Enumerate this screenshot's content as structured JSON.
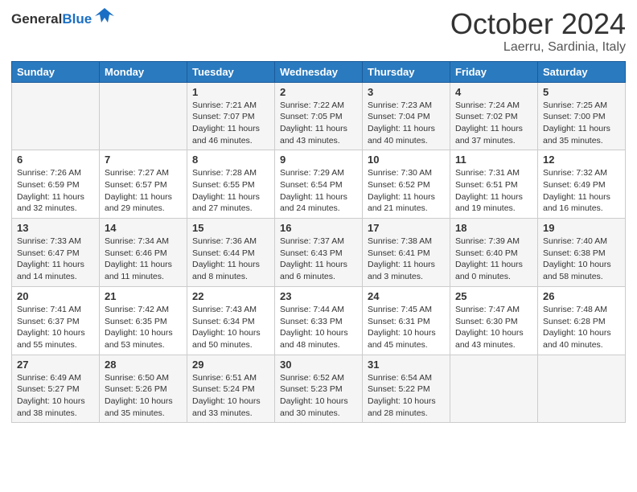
{
  "header": {
    "logo_general": "General",
    "logo_blue": "Blue",
    "month_title": "October 2024",
    "location": "Laerru, Sardinia, Italy"
  },
  "days_of_week": [
    "Sunday",
    "Monday",
    "Tuesday",
    "Wednesday",
    "Thursday",
    "Friday",
    "Saturday"
  ],
  "weeks": [
    [
      null,
      null,
      {
        "day": 1,
        "sunrise": "7:21 AM",
        "sunset": "7:07 PM",
        "daylight": "11 hours and 46 minutes."
      },
      {
        "day": 2,
        "sunrise": "7:22 AM",
        "sunset": "7:05 PM",
        "daylight": "11 hours and 43 minutes."
      },
      {
        "day": 3,
        "sunrise": "7:23 AM",
        "sunset": "7:04 PM",
        "daylight": "11 hours and 40 minutes."
      },
      {
        "day": 4,
        "sunrise": "7:24 AM",
        "sunset": "7:02 PM",
        "daylight": "11 hours and 37 minutes."
      },
      {
        "day": 5,
        "sunrise": "7:25 AM",
        "sunset": "7:00 PM",
        "daylight": "11 hours and 35 minutes."
      }
    ],
    [
      {
        "day": 6,
        "sunrise": "7:26 AM",
        "sunset": "6:59 PM",
        "daylight": "11 hours and 32 minutes."
      },
      {
        "day": 7,
        "sunrise": "7:27 AM",
        "sunset": "6:57 PM",
        "daylight": "11 hours and 29 minutes."
      },
      {
        "day": 8,
        "sunrise": "7:28 AM",
        "sunset": "6:55 PM",
        "daylight": "11 hours and 27 minutes."
      },
      {
        "day": 9,
        "sunrise": "7:29 AM",
        "sunset": "6:54 PM",
        "daylight": "11 hours and 24 minutes."
      },
      {
        "day": 10,
        "sunrise": "7:30 AM",
        "sunset": "6:52 PM",
        "daylight": "11 hours and 21 minutes."
      },
      {
        "day": 11,
        "sunrise": "7:31 AM",
        "sunset": "6:51 PM",
        "daylight": "11 hours and 19 minutes."
      },
      {
        "day": 12,
        "sunrise": "7:32 AM",
        "sunset": "6:49 PM",
        "daylight": "11 hours and 16 minutes."
      }
    ],
    [
      {
        "day": 13,
        "sunrise": "7:33 AM",
        "sunset": "6:47 PM",
        "daylight": "11 hours and 14 minutes."
      },
      {
        "day": 14,
        "sunrise": "7:34 AM",
        "sunset": "6:46 PM",
        "daylight": "11 hours and 11 minutes."
      },
      {
        "day": 15,
        "sunrise": "7:36 AM",
        "sunset": "6:44 PM",
        "daylight": "11 hours and 8 minutes."
      },
      {
        "day": 16,
        "sunrise": "7:37 AM",
        "sunset": "6:43 PM",
        "daylight": "11 hours and 6 minutes."
      },
      {
        "day": 17,
        "sunrise": "7:38 AM",
        "sunset": "6:41 PM",
        "daylight": "11 hours and 3 minutes."
      },
      {
        "day": 18,
        "sunrise": "7:39 AM",
        "sunset": "6:40 PM",
        "daylight": "11 hours and 0 minutes."
      },
      {
        "day": 19,
        "sunrise": "7:40 AM",
        "sunset": "6:38 PM",
        "daylight": "10 hours and 58 minutes."
      }
    ],
    [
      {
        "day": 20,
        "sunrise": "7:41 AM",
        "sunset": "6:37 PM",
        "daylight": "10 hours and 55 minutes."
      },
      {
        "day": 21,
        "sunrise": "7:42 AM",
        "sunset": "6:35 PM",
        "daylight": "10 hours and 53 minutes."
      },
      {
        "day": 22,
        "sunrise": "7:43 AM",
        "sunset": "6:34 PM",
        "daylight": "10 hours and 50 minutes."
      },
      {
        "day": 23,
        "sunrise": "7:44 AM",
        "sunset": "6:33 PM",
        "daylight": "10 hours and 48 minutes."
      },
      {
        "day": 24,
        "sunrise": "7:45 AM",
        "sunset": "6:31 PM",
        "daylight": "10 hours and 45 minutes."
      },
      {
        "day": 25,
        "sunrise": "7:47 AM",
        "sunset": "6:30 PM",
        "daylight": "10 hours and 43 minutes."
      },
      {
        "day": 26,
        "sunrise": "7:48 AM",
        "sunset": "6:28 PM",
        "daylight": "10 hours and 40 minutes."
      }
    ],
    [
      {
        "day": 27,
        "sunrise": "6:49 AM",
        "sunset": "5:27 PM",
        "daylight": "10 hours and 38 minutes."
      },
      {
        "day": 28,
        "sunrise": "6:50 AM",
        "sunset": "5:26 PM",
        "daylight": "10 hours and 35 minutes."
      },
      {
        "day": 29,
        "sunrise": "6:51 AM",
        "sunset": "5:24 PM",
        "daylight": "10 hours and 33 minutes."
      },
      {
        "day": 30,
        "sunrise": "6:52 AM",
        "sunset": "5:23 PM",
        "daylight": "10 hours and 30 minutes."
      },
      {
        "day": 31,
        "sunrise": "6:54 AM",
        "sunset": "5:22 PM",
        "daylight": "10 hours and 28 minutes."
      },
      null,
      null
    ]
  ]
}
